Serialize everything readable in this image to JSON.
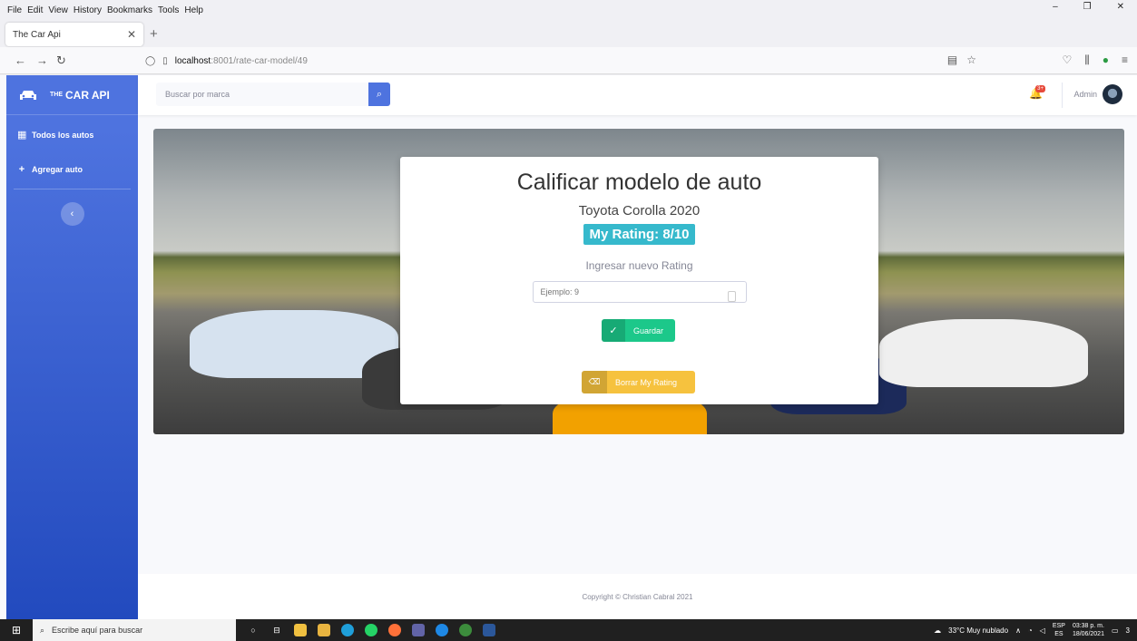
{
  "browser": {
    "menu": [
      "File",
      "Edit",
      "View",
      "History",
      "Bookmarks",
      "Tools",
      "Help"
    ],
    "tab_title": "The Car Api",
    "url_host": "localhost",
    "url_path": ":8001/rate-car-model/49"
  },
  "sidebar": {
    "brand_sup": "THE",
    "brand_name": "CAR API",
    "items": [
      {
        "label": "Todos los autos",
        "icon": "table-icon"
      },
      {
        "label": "Agregar auto",
        "icon": "plus-icon"
      }
    ],
    "toggle_icon": "‹"
  },
  "topbar": {
    "search_placeholder": "Buscar por marca",
    "alert_count": "3+",
    "user_name": "Admin"
  },
  "modal": {
    "title": "Calificar modelo de auto",
    "model_name": "Toyota Corolla 2020",
    "my_rating": "My Rating: 8/10",
    "new_rating_label": "Ingresar nuevo Rating",
    "input_placeholder": "Ejemplo: 9",
    "save_label": "Guardar",
    "delete_label": "Borrar My Rating"
  },
  "footer": {
    "copyright": "Copyright © Christian Cabral 2021"
  },
  "taskbar": {
    "search_placeholder": "Escribe aquí para buscar",
    "weather": "33°C  Muy nublado",
    "lang_top": "ESP",
    "lang_bottom": "ES",
    "time": "03:38 p. m.",
    "date": "18/06/2021",
    "notif_count": "3"
  },
  "colors": {
    "primary": "#4e73df",
    "info": "#36b9cc",
    "success": "#1cc88a",
    "warning": "#f6c23e"
  }
}
